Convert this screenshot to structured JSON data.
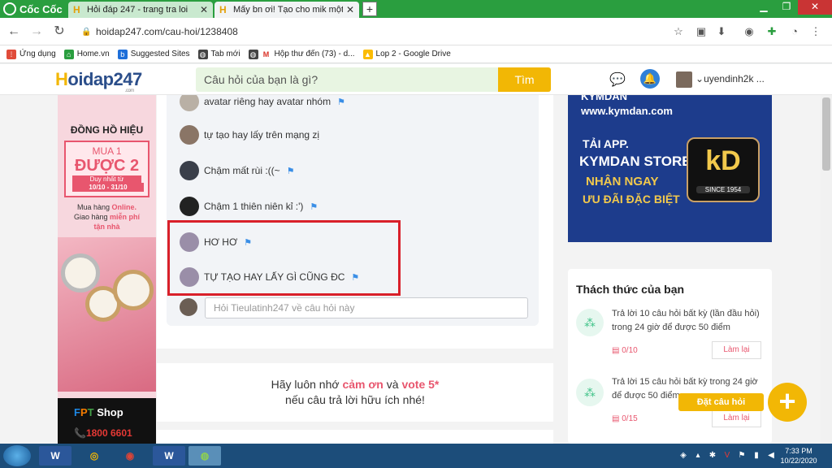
{
  "browser": {
    "logo": "Cốc Cốc",
    "tabs": [
      {
        "title": "Hỏi đáp 247 - trang tra loi"
      },
      {
        "title": "Mấy bn ơi! Tạo cho mik một á"
      }
    ],
    "new_tab": "+",
    "url": "hoidap247.com/cau-hoi/1238408"
  },
  "bookmarks": [
    {
      "label": "Ứng dụng"
    },
    {
      "label": "Home.vn"
    },
    {
      "label": "Suggested Sites"
    },
    {
      "label": "Tab mới"
    },
    {
      "label": "Hộp thư đến (73) - d..."
    },
    {
      "label": "Lop 2 - Google Drive"
    }
  ],
  "site": {
    "logo_prefix": "H",
    "logo_rest": "oidap247",
    "logo_com": ".com",
    "search_placeholder": "Câu hỏi của bạn là gì?",
    "search_button": "Tìm",
    "username": "uyendinh2k ..."
  },
  "comments": [
    {
      "text": "avatar riêng hay avatar nhóm",
      "flag": true
    },
    {
      "text": "tự tạo hay lấy trên mạng zị",
      "flag": false
    },
    {
      "text": "Chậm mất rùi :((~",
      "flag": true
    },
    {
      "text": "Chậm 1 thiên niên kỉ :')",
      "flag": true
    },
    {
      "text": "HƠ HƠ",
      "flag": true
    },
    {
      "text": "TỰ TẠO HAY LẤY GÌ CŨNG ĐC",
      "flag": true
    }
  ],
  "reply_placeholder": "Hỏi Tieulatinh247 về câu hỏi này",
  "thanks": {
    "prefix": "Hãy luôn nhớ ",
    "cam_on": "cảm ơn",
    "middle": " và ",
    "vote": "vote 5*",
    "line2": "nếu câu trả lời hữu ích nhé!"
  },
  "left_ad": {
    "brand": "ĐỒNG HỒ HIỆU",
    "promo1": "MUA 1",
    "promo2": "ĐƯỢC 2",
    "promo3": "Duy nhất từ",
    "dates": "10/10 - 31/10",
    "online_line1": "Mua hàng ",
    "online_hl": "Online.",
    "online_line2": "Giao hàng ",
    "online_hl2": "miễn phí",
    "online_line3": "tận nhà",
    "fpt_f": "F",
    "fpt_p": "P",
    "fpt_t": "T",
    "fpt_shop": " Shop",
    "phone": "📞1800 6601"
  },
  "right_ad": {
    "url": "www.kymdan.com",
    "url_top": "KYMDAN",
    "app_line": "TẢI APP.",
    "store_line": "KYMDAN STORE",
    "nhan_line": "NHẬN NGAY",
    "uudai_line": "ƯU ĐÃI ĐẶC BIỆT",
    "badge_text": "kD",
    "since": "SINCE 1954"
  },
  "challenge": {
    "title": "Thách thức của bạn",
    "items": [
      {
        "text": "Trả lời 10 câu hỏi  bất kỳ (lần đầu hỏi) trong 24 giờ để được 50 điểm",
        "progress": "0/10",
        "button": "Làm lại"
      },
      {
        "text": "Trả lời 15 câu hỏi  bất kỳ  trong 24 giờ để được 50 điểm",
        "progress": "0/15",
        "button": "Làm lại"
      }
    ]
  },
  "fab": {
    "label": "Đặt câu hỏi",
    "icon": "+"
  },
  "clock": {
    "time": "7:33 PM",
    "date": "10/22/2020"
  },
  "colors": {
    "accent_yellow": "#f2b705",
    "highlight_red": "#d9202a",
    "brand_blue": "#2b4e8a",
    "browser_green": "#2a9e3f"
  }
}
